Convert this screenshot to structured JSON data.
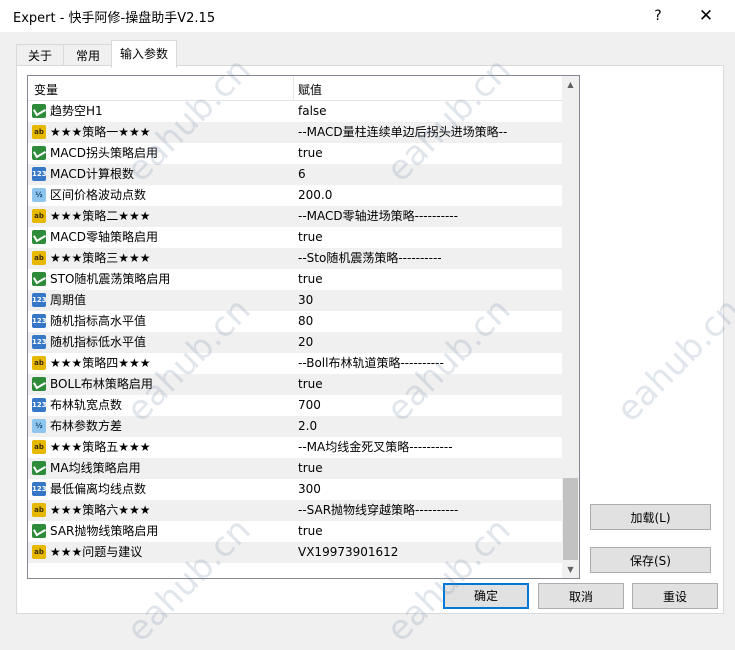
{
  "window": {
    "title": "Expert - 快手阿修-操盘助手V2.15",
    "help_label": "?",
    "close_label": "✕"
  },
  "tabs": [
    {
      "label": "关于"
    },
    {
      "label": "常用"
    },
    {
      "label": "输入参数",
      "active": true
    }
  ],
  "table": {
    "headers": {
      "name": "变量",
      "value": "赋值"
    },
    "rows": [
      {
        "icon": "bool-icon",
        "name": "趋势空H1",
        "value": "false"
      },
      {
        "icon": "string-icon",
        "name": "★★★策略一★★★",
        "value": "--MACD量柱连续单边后拐头进场策略--"
      },
      {
        "icon": "bool-icon",
        "name": "MACD拐头策略启用",
        "value": "true"
      },
      {
        "icon": "int-icon",
        "name": "MACD计算根数",
        "value": "6"
      },
      {
        "icon": "double-icon",
        "name": "区间价格波动点数",
        "value": "200.0"
      },
      {
        "icon": "string-icon",
        "name": "★★★策略二★★★",
        "value": "--MACD零轴进场策略----------"
      },
      {
        "icon": "bool-icon",
        "name": "MACD零轴策略启用",
        "value": "true"
      },
      {
        "icon": "string-icon",
        "name": "★★★策略三★★★",
        "value": "--Sto随机震荡策略----------"
      },
      {
        "icon": "bool-icon",
        "name": "STO随机震荡策略启用",
        "value": "true"
      },
      {
        "icon": "int-icon",
        "name": "周期值",
        "value": "30"
      },
      {
        "icon": "int-icon",
        "name": "随机指标高水平值",
        "value": "80"
      },
      {
        "icon": "int-icon",
        "name": "随机指标低水平值",
        "value": "20"
      },
      {
        "icon": "string-icon",
        "name": "★★★策略四★★★",
        "value": "--Boll布林轨道策略----------"
      },
      {
        "icon": "bool-icon",
        "name": "BOLL布林策略启用",
        "value": "true"
      },
      {
        "icon": "int-icon",
        "name": "布林轨宽点数",
        "value": "700"
      },
      {
        "icon": "double-icon",
        "name": "布林参数方差",
        "value": "2.0"
      },
      {
        "icon": "string-icon",
        "name": "★★★策略五★★★",
        "value": "--MA均线金死叉策略----------"
      },
      {
        "icon": "bool-icon",
        "name": "MA均线策略启用",
        "value": "true"
      },
      {
        "icon": "int-icon",
        "name": "最低偏离均线点数",
        "value": "300"
      },
      {
        "icon": "string-icon",
        "name": "★★★策略六★★★",
        "value": "--SAR抛物线穿越策略----------"
      },
      {
        "icon": "bool-icon",
        "name": "SAR抛物线策略启用",
        "value": "true"
      },
      {
        "icon": "string-icon",
        "name": "★★★问题与建议",
        "value": "VX19973901612"
      }
    ]
  },
  "icon_text": {
    "string": "ab",
    "int": "123",
    "double": "½"
  },
  "buttons": {
    "load": "加载(L)",
    "save": "保存(S)",
    "ok": "确定",
    "cancel": "取消",
    "reset": "重设"
  },
  "watermark_text": "eahub.cn",
  "colors": {
    "bool_icon": "#2e8b3a",
    "string_icon": "#e6b800",
    "int_icon": "#3677c8",
    "double_icon": "#8fc6ee",
    "default_button_border": "#0078d7"
  }
}
